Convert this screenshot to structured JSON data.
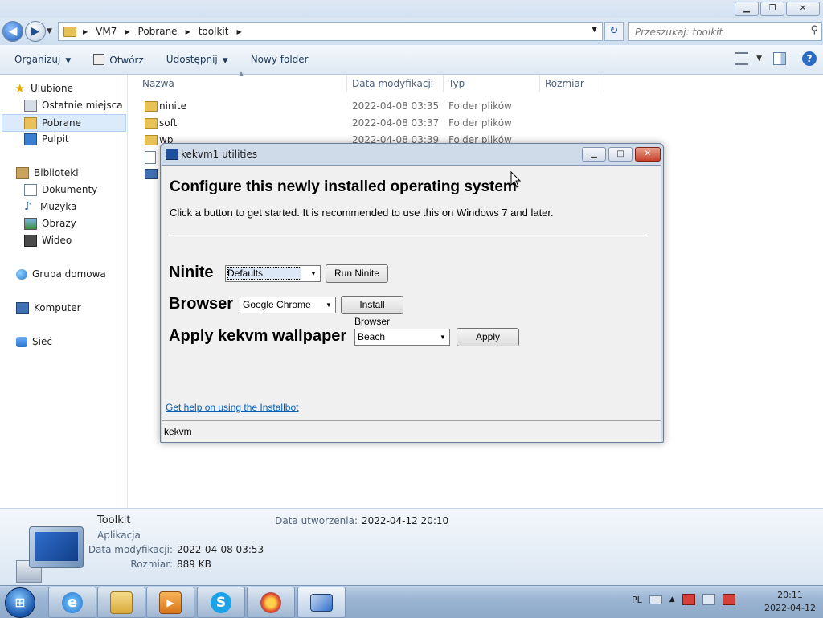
{
  "explorer": {
    "breadcrumb": [
      "VM7",
      "Pobrane",
      "toolkit"
    ],
    "search_placeholder": "Przeszukaj: toolkit",
    "toolbar": {
      "organize": "Organizuj",
      "open": "Otwórz",
      "share": "Udostępnij",
      "new_folder": "Nowy folder"
    },
    "nav": {
      "favorites": "Ulubione",
      "recent": "Ostatnie miejsca",
      "downloads": "Pobrane",
      "desktop": "Pulpit",
      "libraries": "Biblioteki",
      "documents": "Dokumenty",
      "music": "Muzyka",
      "pictures": "Obrazy",
      "videos": "Wideo",
      "homegroup": "Grupa domowa",
      "computer": "Komputer",
      "network": "Sieć"
    },
    "columns": {
      "name": "Nazwa",
      "modified": "Data modyfikacji",
      "type": "Typ",
      "size": "Rozmiar"
    },
    "files": [
      {
        "name": "ninite",
        "modified": "2022-04-08 03:35",
        "type": "Folder plików"
      },
      {
        "name": "soft",
        "modified": "2022-04-08 03:37",
        "type": "Folder plików"
      },
      {
        "name": "wp",
        "modified": "2022-04-08 03:39",
        "type": "Folder plików"
      }
    ],
    "details": {
      "name": "Toolkit",
      "kind": "Aplikacja",
      "modified_label": "Data modyfikacji:",
      "modified_value": "2022-04-08 03:53",
      "size_label": "Rozmiar:",
      "size_value": "889 KB",
      "created_label": "Data utworzenia:",
      "created_value": "2022-04-12 20:10"
    }
  },
  "dialog": {
    "title": "kekvm1 utilities",
    "heading": "Configure this newly installed operating system",
    "subtitle": "Click a button to get started. It is recommended to use this on Windows 7 and later.",
    "ninite": {
      "label": "Ninite",
      "selected": "Defaults",
      "button": "Run Ninite"
    },
    "browser": {
      "label": "Browser",
      "selected": "Google Chrome",
      "button": "Install Browser"
    },
    "wallpaper": {
      "label": "Apply kekvm wallpaper",
      "selected": "Beach",
      "button": "Apply"
    },
    "help_link": "Get help on using the Installbot",
    "status": "kekvm"
  },
  "taskbar": {
    "language": "PL",
    "time": "20:11",
    "date": "2022-04-12"
  }
}
